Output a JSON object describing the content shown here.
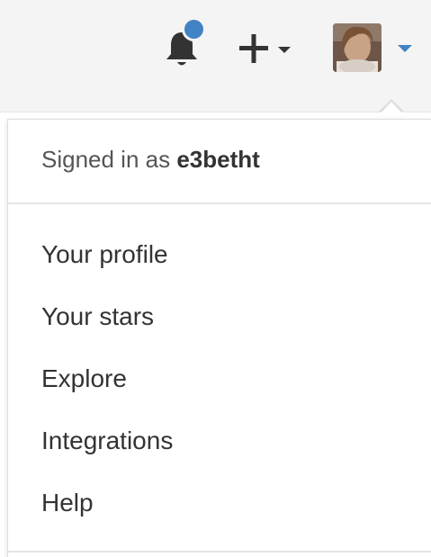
{
  "header": {
    "notification_icon": "bell-icon",
    "notification_dot_color": "#4183c4",
    "create_icon": "plus-icon",
    "avatar_icon": "user-avatar",
    "caret_color": "#4183c4"
  },
  "dropdown": {
    "signed_in_prefix": "Signed in as",
    "username": "e3betht",
    "items": [
      {
        "label": "Your profile"
      },
      {
        "label": "Your stars"
      },
      {
        "label": "Explore"
      },
      {
        "label": "Integrations"
      },
      {
        "label": "Help"
      }
    ]
  }
}
